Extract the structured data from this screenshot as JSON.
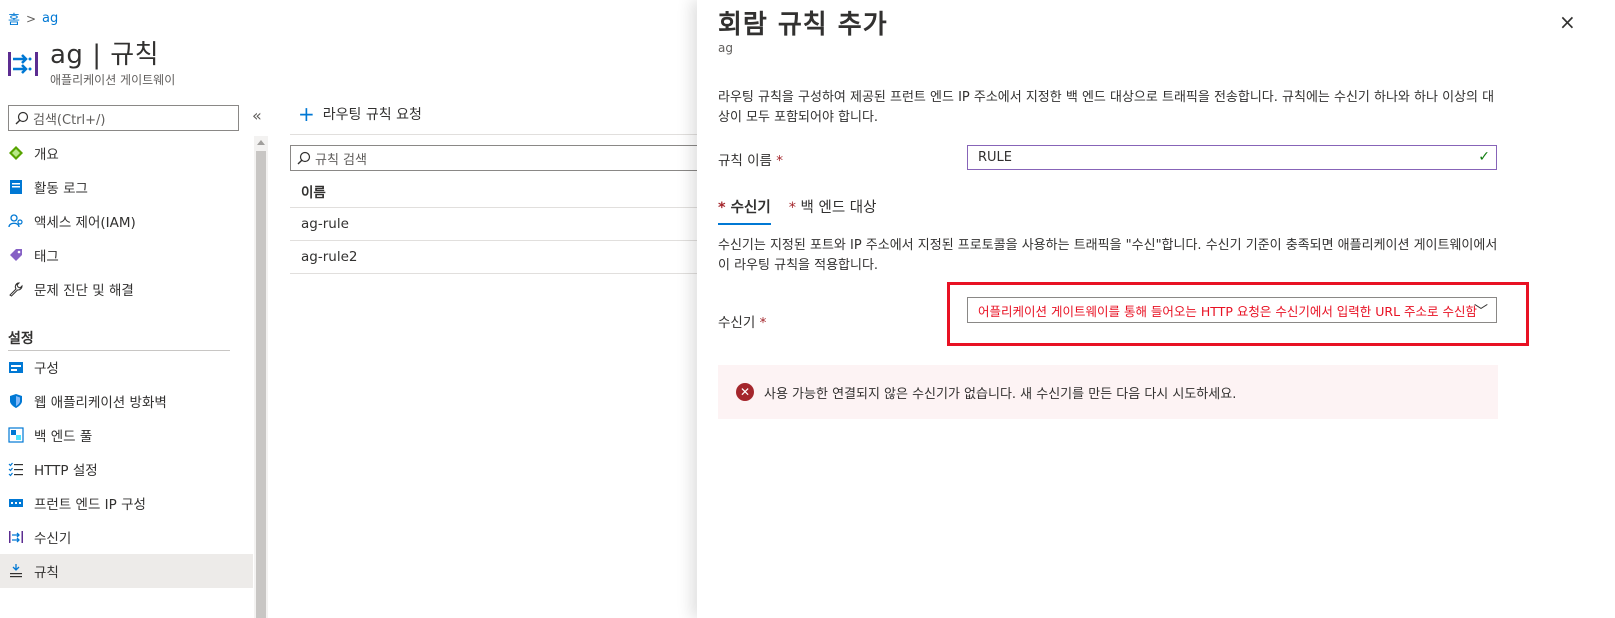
{
  "breadcrumb": {
    "home": "홈",
    "separator": ">",
    "current": "ag"
  },
  "resource": {
    "title": "ag | 규칙",
    "subtitle": "애플리케이션 게이트웨이"
  },
  "sidebar": {
    "search_placeholder": "검색(Ctrl+/)",
    "collapse_label": "«",
    "items": [
      {
        "label": "개요",
        "icon": "overview-icon"
      },
      {
        "label": "활동 로그",
        "icon": "activity-log-icon"
      },
      {
        "label": "액세스 제어(IAM)",
        "icon": "access-control-icon"
      },
      {
        "label": "태그",
        "icon": "tag-icon"
      },
      {
        "label": "문제 진단 및 해결",
        "icon": "wrench-icon"
      }
    ],
    "section_label": "설정",
    "settings_items": [
      {
        "label": "구성",
        "icon": "config-icon"
      },
      {
        "label": "웹 애플리케이션 방화벽",
        "icon": "shield-icon"
      },
      {
        "label": "백 엔드 풀",
        "icon": "backend-pool-icon"
      },
      {
        "label": "HTTP 설정",
        "icon": "list-icon"
      },
      {
        "label": "프런트 엔드 IP 구성",
        "icon": "frontend-ip-icon"
      },
      {
        "label": "수신기",
        "icon": "listener-icon"
      },
      {
        "label": "규칙",
        "icon": "rules-icon",
        "active": true
      }
    ]
  },
  "main": {
    "add_rule_label": "라우팅 규칙 요청",
    "filter_placeholder": "규칙 검색",
    "column_header": "이름",
    "rows": [
      "ag-rule",
      "ag-rule2"
    ]
  },
  "panel": {
    "title": "회람 규칙 추가",
    "subtitle": "ag",
    "close": "×",
    "description": "라우팅 규칙을 구성하여 제공된 프런트 엔드 IP 주소에서 지정한 백 엔드 대상으로 트래픽을 전송합니다. 규칙에는 수신기 하나와 하나 이상의 대상이 모두 포함되어야 합니다.",
    "rule_name_label": "규칙 이름",
    "required_mark": "*",
    "rule_name_value": "RULE",
    "tabs": [
      {
        "label": "수신기",
        "active": true
      },
      {
        "label": "백 엔드 대상",
        "active": false
      }
    ],
    "listener_description": "수신기는 지정된 포트와 IP 주소에서 지정된 프로토콜을 사용하는 트래픽을 \"수신\"합니다. 수신기 기준이 충족되면 애플리케이션 게이트웨이에서 이 라우팅 규칙을 적용합니다.",
    "listener_label": "수신기",
    "listener_value": "어플리케이션 게이트웨이를 통해 들어오는 HTTP 요청은 수신기에서 입력한 URL 주소로 수신함",
    "error_message": "사용 가능한 연결되지 않은 수신기가 없습니다. 새 수신기를 만든 다음 다시 시도하세요."
  },
  "colors": {
    "accent": "#0078d4",
    "error": "#e81123",
    "highlight_border": "#e81123",
    "error_bg": "#fdf3f4"
  }
}
